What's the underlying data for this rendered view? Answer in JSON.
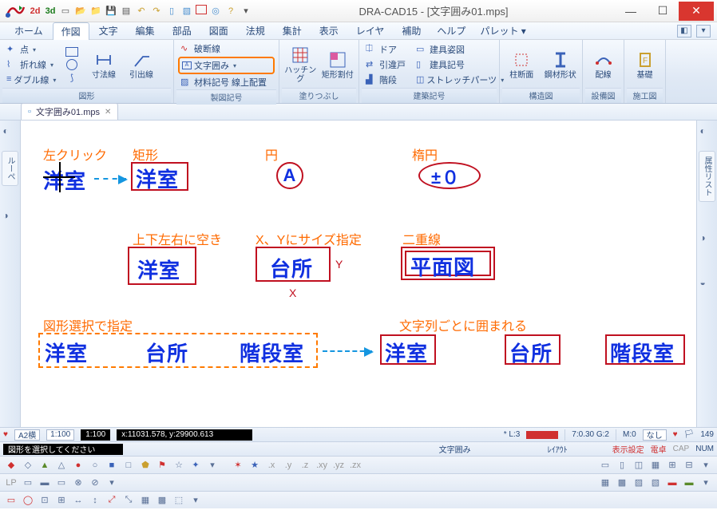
{
  "title": "DRA-CAD15 - [文字囲み01.mps]",
  "menu": [
    "ホーム",
    "作図",
    "文字",
    "編集",
    "部品",
    "図面",
    "法規",
    "集計",
    "表示",
    "レイヤ",
    "補助",
    "ヘルプ",
    "パレット ▾"
  ],
  "menu_active_index": 1,
  "ribbon_groups": [
    {
      "label": "図形",
      "stack": [
        "点",
        "折れ線",
        "ダブル線"
      ],
      "big": [
        "寸法線",
        "引出線"
      ]
    },
    {
      "label": "製図記号",
      "stack": [
        "破断線",
        "文字囲み",
        "材料記号 線上配置"
      ],
      "highlight_index": 1
    },
    {
      "label": "塗りつぶし",
      "big": [
        "ハッチング",
        "矩形割付"
      ]
    },
    {
      "label": "建築記号",
      "cols": [
        [
          "ドア",
          "引違戸",
          "階段"
        ],
        [
          "建具姿図",
          "建具記号",
          "ストレッチパーツ"
        ]
      ]
    },
    {
      "label": "構造図",
      "big": [
        "柱断面",
        "鋼材形状"
      ]
    },
    {
      "label": "設備図",
      "big": [
        "配線"
      ]
    },
    {
      "label": "施工図",
      "big": [
        "基礎"
      ]
    }
  ],
  "doc_tab": "文字囲み01.mps",
  "side_left_tab": "ルーペ",
  "side_right_tab": "属性リスト",
  "canvas": {
    "left_click": "左クリック",
    "rect_lbl": "矩形",
    "circle_lbl": "円",
    "ellipse_lbl": "楕円",
    "yoshitsu": "洋室",
    "circle_a": "A",
    "pm0": "±０",
    "spacing": "上下左右に空き",
    "size_xy": "X、Yにサイズ指定",
    "double": "二重線",
    "daidokoro": "台所",
    "heimenzu": "平面図",
    "shape_select": "図形選択で指定",
    "each_enclosed": "文字列ごとに囲まれる",
    "kaidanshitsu": "階段室",
    "X": "X",
    "Y": "Y"
  },
  "status1": {
    "paper": "A2横",
    "scale1": "1:100",
    "scale2": "1:100",
    "coords": "x:11031.578, y:29900.613",
    "layer": "*  L:3",
    "grid": "7:0.30  G:2",
    "m": "M:0",
    "nashi": "なし",
    "count": "149"
  },
  "status2": {
    "prompt": "図形を選択してください",
    "mode": "文字囲み",
    "layout": "ﾚｲｱｳﾄ",
    "disp": "表示設定",
    "densha": "電卓",
    "cap": "CAP",
    "num": "NUM"
  },
  "icons": {
    "qat": [
      "2d",
      "3d",
      "□",
      "▭",
      "◨",
      "▤",
      "↶",
      "↷",
      "▯",
      "▧",
      "□",
      "◎",
      "?",
      "▾"
    ]
  }
}
